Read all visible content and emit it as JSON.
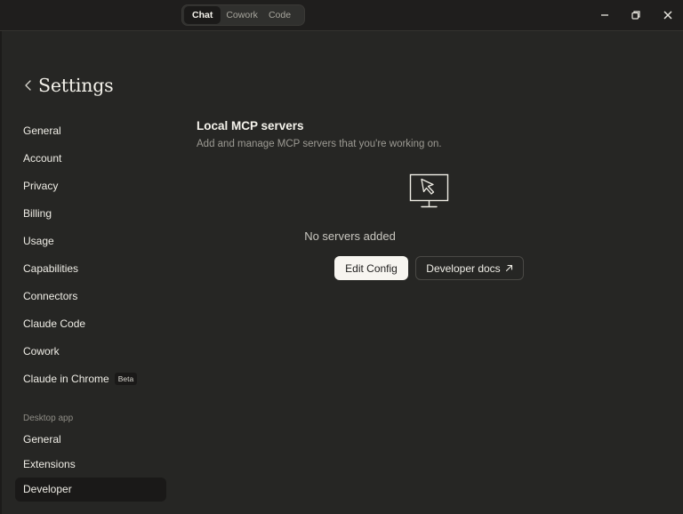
{
  "titlebar": {
    "tabs": [
      {
        "label": "Chat",
        "active": true
      },
      {
        "label": "Cowork",
        "active": false
      },
      {
        "label": "Code",
        "active": false
      }
    ],
    "window_controls": [
      "minimize-icon",
      "restore-icon",
      "close-icon"
    ]
  },
  "settings": {
    "title": "Settings"
  },
  "sidebar": {
    "items": [
      {
        "label": "General"
      },
      {
        "label": "Account"
      },
      {
        "label": "Privacy"
      },
      {
        "label": "Billing"
      },
      {
        "label": "Usage"
      },
      {
        "label": "Capabilities"
      },
      {
        "label": "Connectors"
      },
      {
        "label": "Claude Code"
      },
      {
        "label": "Cowork"
      },
      {
        "label": "Claude in Chrome",
        "badge": "Beta"
      }
    ],
    "desktop_section_label": "Desktop app",
    "desktop_items": [
      {
        "label": "General"
      },
      {
        "label": "Extensions"
      },
      {
        "label": "Developer",
        "active": true
      }
    ]
  },
  "main": {
    "title": "Local MCP servers",
    "subtitle": "Add and manage MCP servers that you're working on.",
    "empty_icon": "monitor-cursor-icon",
    "empty_text": "No servers added",
    "edit_button": "Edit Config",
    "docs_button": "Developer docs"
  },
  "colors": {
    "background": "#262624",
    "titlebar": "#1f1e1d",
    "active_nav": "#1a1918",
    "primary_button": "#f7f5f0"
  }
}
